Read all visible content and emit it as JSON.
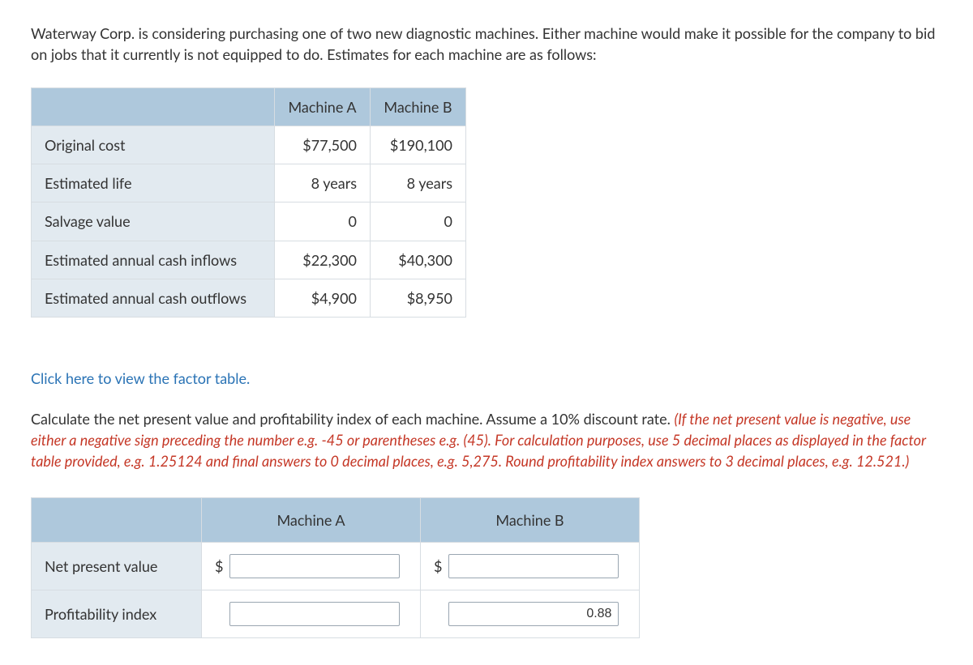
{
  "intro": "Waterway Corp. is considering purchasing one of two new diagnostic machines. Either machine would make it possible for the company to bid on jobs that it currently is not equipped to do. Estimates for each machine are as follows:",
  "spec": {
    "headers": {
      "a": "Machine A",
      "b": "Machine B"
    },
    "rows": [
      {
        "label": "Original cost",
        "a": "$77,500",
        "b": "$190,100"
      },
      {
        "label": "Estimated life",
        "a": "8 years",
        "b": "8 years"
      },
      {
        "label": "Salvage value",
        "a": "0",
        "b": "0"
      },
      {
        "label": "Estimated annual cash inflows",
        "a": "$22,300",
        "b": "$40,300"
      },
      {
        "label": "Estimated annual cash outflows",
        "a": "$4,900",
        "b": "$8,950"
      }
    ]
  },
  "factor_link": "Click here to view the factor table.",
  "instructions_plain": "Calculate the net present value and profitability index of each machine. Assume a 10% discount rate. ",
  "instructions_italic": "(If the net present value is negative, use either a negative sign preceding the number e.g. -45 or parentheses e.g. (45). For calculation purposes, use 5 decimal places as displayed in the factor table provided, e.g. 1.25124 and final answers to 0 decimal places, e.g. 5,275. Round profitability index answers to 3 decimal places, e.g. 12.521.)",
  "answers": {
    "headers": {
      "a": "Machine A",
      "b": "Machine B"
    },
    "npv_label": "Net present value",
    "pi_label": "Profitability index",
    "currency": "$",
    "values": {
      "npv_a": "",
      "npv_b": "",
      "pi_a": "",
      "pi_b": "0.88"
    }
  }
}
